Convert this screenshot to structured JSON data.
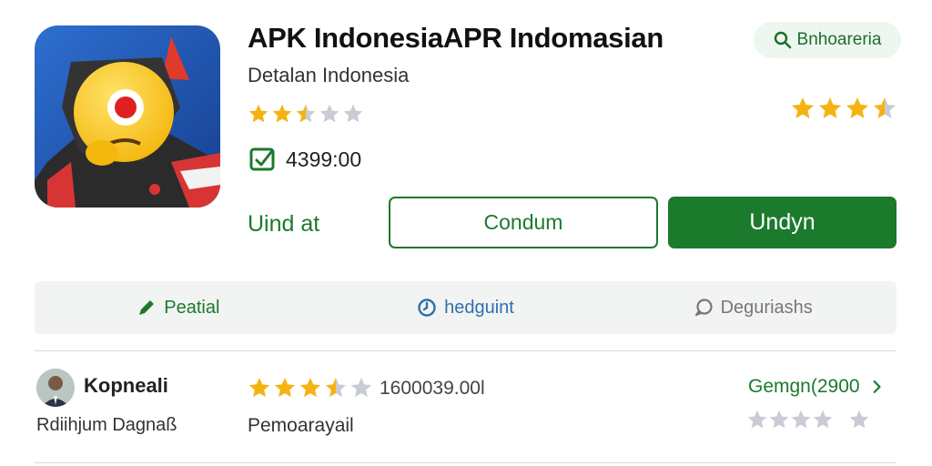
{
  "app": {
    "title": "APK IndonesiaAPR Indomasian",
    "subtitle": "Detalan Indonesia",
    "rating_stars": 2.5,
    "download_count": "4399:00"
  },
  "header_right": {
    "search_chip_label": "Bnhoareria",
    "rating_stars": 3.5
  },
  "actions": {
    "link_label": "Uind at",
    "secondary_button": "Condum",
    "primary_button": "Undyn"
  },
  "tabs": [
    {
      "label": "Peatial",
      "icon": "pencil-icon"
    },
    {
      "label": "hedguint",
      "icon": "clock-icon"
    },
    {
      "label": "Deguriashs",
      "icon": "chat-icon"
    }
  ],
  "review": {
    "reviewer_name": "Kopneali",
    "reviewer_subtitle": "Rdiihjum Dagnaß",
    "rating_stars": 3.5,
    "count": "1600039.00l",
    "body": "Pemoarayail",
    "link_label": "Gemgn(2900",
    "gray_stars_count": 5
  },
  "colors": {
    "accent_green": "#1b7a2c",
    "star_gold": "#f5b312",
    "star_gray": "#c9ccd4",
    "chip_bg": "#edf6ef",
    "tab_bg": "#f1f4f2",
    "tab_blue": "#2f6fb0"
  }
}
